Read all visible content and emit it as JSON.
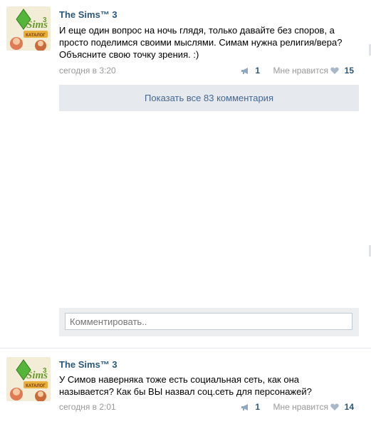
{
  "posts": [
    {
      "author": "The Sims™ 3",
      "text": "И еще один вопрос на ночь глядя, только давайте без споров, а просто поделимся своими мыслями. Симам нужна религия/вера? Объясните свою точку зрения. :)",
      "time": "сегодня в 3:20",
      "shares": "1",
      "like_label": "Мне нравится",
      "likes": "15"
    },
    {
      "author": "The Sims™ 3",
      "text": "У Симов наверняка тоже есть социальная сеть, как она называется? Как бы ВЫ назвал соц.сеть для персонажей?",
      "time": "сегодня в 2:01",
      "shares": "1",
      "like_label": "Мне нравится",
      "likes": "14"
    }
  ],
  "show_all_comments": "Показать все 83 комментария",
  "comment_placeholder": "Комментировать..",
  "avatar_logo": "SIMS 3",
  "avatar_badge": "КАТАЛОГ",
  "colors": {
    "link": "#2b587a",
    "button_bg": "#e6e9ee",
    "meta": "#999999"
  }
}
